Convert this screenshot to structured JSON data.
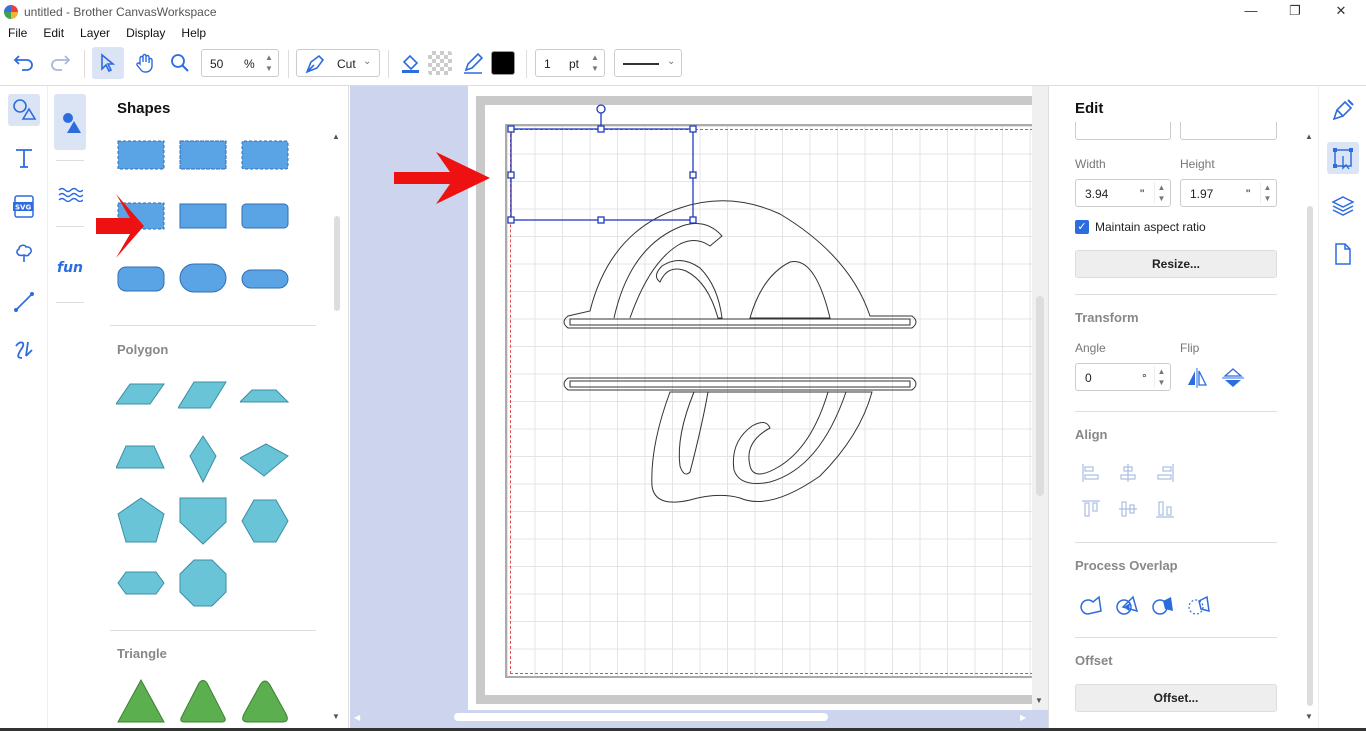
{
  "window": {
    "title": "untitled - Brother CanvasWorkspace",
    "controls": {
      "minimize": "—",
      "restore": "❐",
      "close": "✕"
    }
  },
  "menu": [
    "File",
    "Edit",
    "Layer",
    "Display",
    "Help"
  ],
  "toolbar": {
    "zoom_value": "50",
    "zoom_unit": "%",
    "mode_label": "Cut",
    "line_width_value": "1",
    "line_width_unit": "pt",
    "fill_color": "#000000",
    "icons": [
      "undo-icon",
      "redo-icon",
      "select-pointer-icon",
      "hand-pan-icon",
      "zoom-icon",
      "pen-tool-icon",
      "fill-bucket-icon",
      "transparent-pattern-icon",
      "line-color-icon",
      "line-style-icon"
    ]
  },
  "left_rail": {
    "icons": [
      "shapes-icon",
      "text-icon",
      "svg-icon",
      "tree-icon",
      "line-icon",
      "freehand-icon"
    ]
  },
  "categories": {
    "icons": [
      "basic-shapes-icon",
      "wave-icon",
      "fun-text-icon"
    ],
    "fun_label": "fun"
  },
  "shapes_panel": {
    "title": "Shapes",
    "sections": [
      "Polygon",
      "Triangle"
    ],
    "shape_color": "#5aa4e6",
    "polygon_color": "#68c4d6",
    "triangle_color": "#5caf4f"
  },
  "edit_panel": {
    "title": "Edit",
    "width_label": "Width",
    "height_label": "Height",
    "width_value": "3.94",
    "height_value": "1.97",
    "unit": "\"",
    "maintain_aspect": "Maintain aspect ratio",
    "maintain_aspect_checked": true,
    "resize_button": "Resize...",
    "transform_label": "Transform",
    "angle_label": "Angle",
    "flip_label": "Flip",
    "angle_value": "0",
    "angle_unit": "°",
    "align_label": "Align",
    "process_overlap_label": "Process Overlap",
    "offset_label": "Offset",
    "offset_button": "Offset..."
  },
  "right_rail": {
    "icons": [
      "paint-brush-icon",
      "edit-transform-icon",
      "layers-icon",
      "page-icon"
    ]
  },
  "colors": {
    "accent": "#2d6cdf",
    "selection": "#1f3bbf",
    "arrow_annotation": "#ee1111",
    "canvas_bg": "#cdd5ee"
  }
}
